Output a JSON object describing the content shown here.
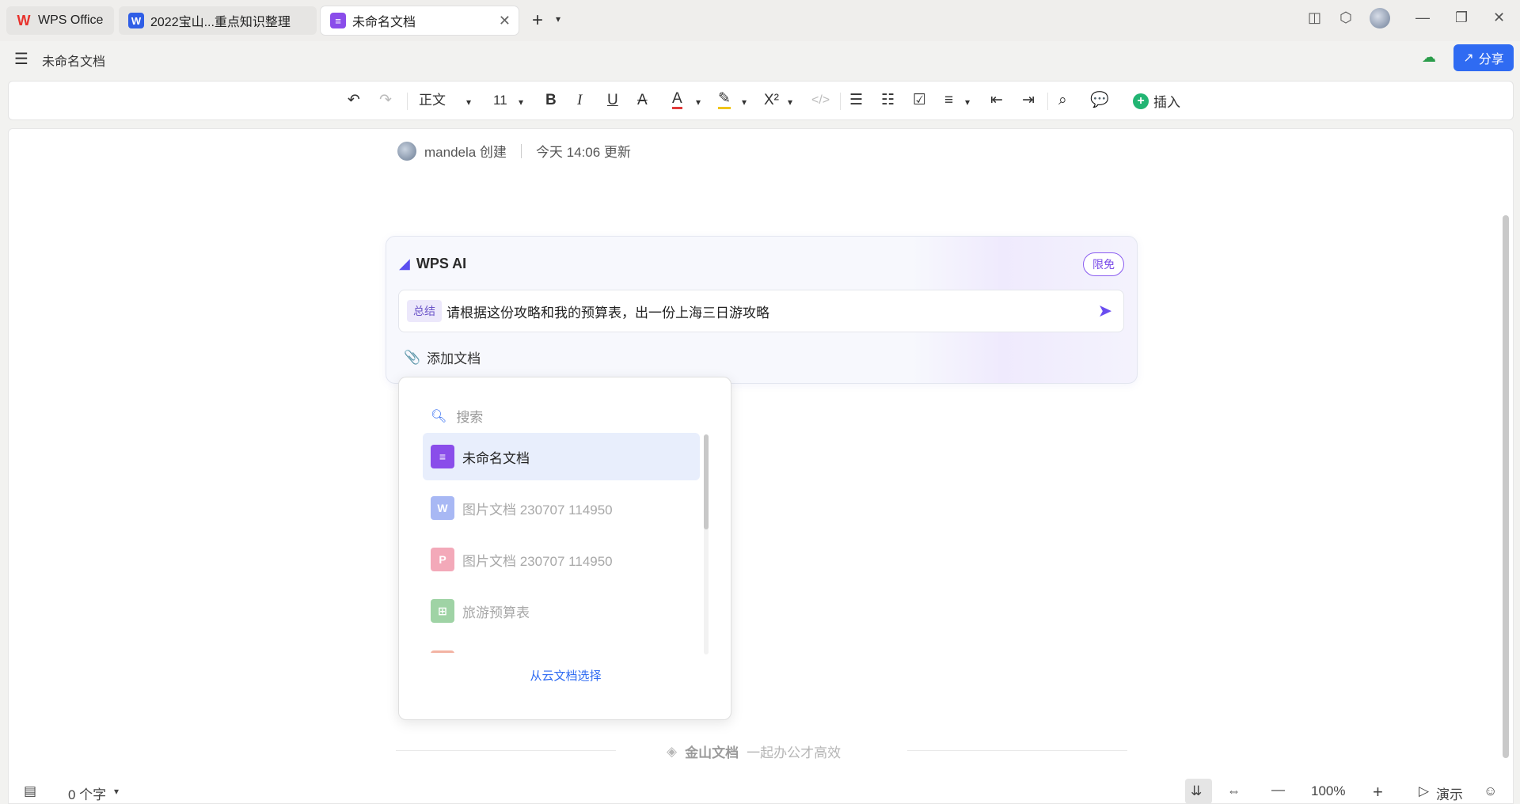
{
  "tabs": [
    {
      "label": "WPS Office",
      "icon": "wps-logo-icon"
    },
    {
      "label": "2022宝山...重点知识整理",
      "icon": "word-doc-icon"
    },
    {
      "label": "未命名文档",
      "icon": "wps-doc-icon",
      "active": true
    }
  ],
  "title_row": {
    "doc_title": "未命名文档",
    "share_label": "分享"
  },
  "toolbar": {
    "style_label": "正文",
    "font_size": "11",
    "insert_label": "插入"
  },
  "doc": {
    "creator": "mandela 创建",
    "updated": "今天 14:06 更新"
  },
  "ai": {
    "title": "WPS AI",
    "badge": "限免",
    "tag": "总结",
    "prompt": "请根据这份攻略和我的预算表，出一份上海三日游攻略",
    "add_doc_label": "添加文档"
  },
  "dropdown": {
    "search_placeholder": "搜索",
    "items": [
      {
        "label": "未命名文档",
        "type": "wps-doc",
        "color": "#8a4dea",
        "selected": true
      },
      {
        "label": "图片文档 230707 114950",
        "type": "word",
        "color": "#a8b8f4"
      },
      {
        "label": "图片文档 230707 114950",
        "type": "ppt",
        "color": "#f3a9b9"
      },
      {
        "label": "旅游预算表",
        "type": "sheet",
        "color": "#9fd3a5"
      }
    ],
    "cloud_label": "从云文档选择"
  },
  "footer": {
    "brand": "金山文档",
    "slogan": "一起办公才高效"
  },
  "status": {
    "word_count": "0 个字",
    "zoom": "100%",
    "present_label": "演示"
  },
  "colors": {
    "accent": "#2f6bf2",
    "ai_purple": "#6a4df0",
    "insert_green": "#22b573"
  }
}
